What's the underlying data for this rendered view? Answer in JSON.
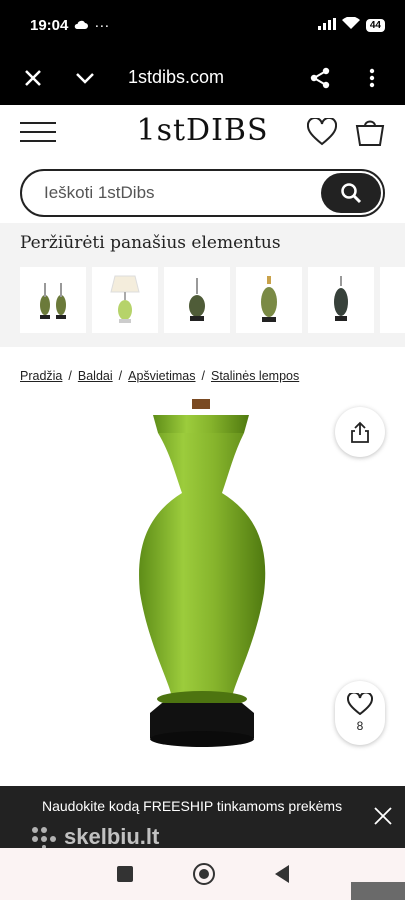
{
  "status": {
    "time": "19:04",
    "battery": "44"
  },
  "browser": {
    "url": "1stdibs.com"
  },
  "header": {
    "logo": "1stDIBS"
  },
  "search": {
    "placeholder": "Ieškoti 1stDibs"
  },
  "similar": {
    "title": "Peržiūrėti panašius elementus"
  },
  "breadcrumb": {
    "items": [
      "Pradžia",
      "Baldai",
      "Apšvietimas",
      "Stalinės lempos"
    ]
  },
  "product": {
    "favorites_count": "8",
    "vase_color": "#86b42c"
  },
  "promo": {
    "text": "Naudokite kodą FREESHIP tinkamoms prekėms",
    "watermark": "skelbiu.lt"
  }
}
